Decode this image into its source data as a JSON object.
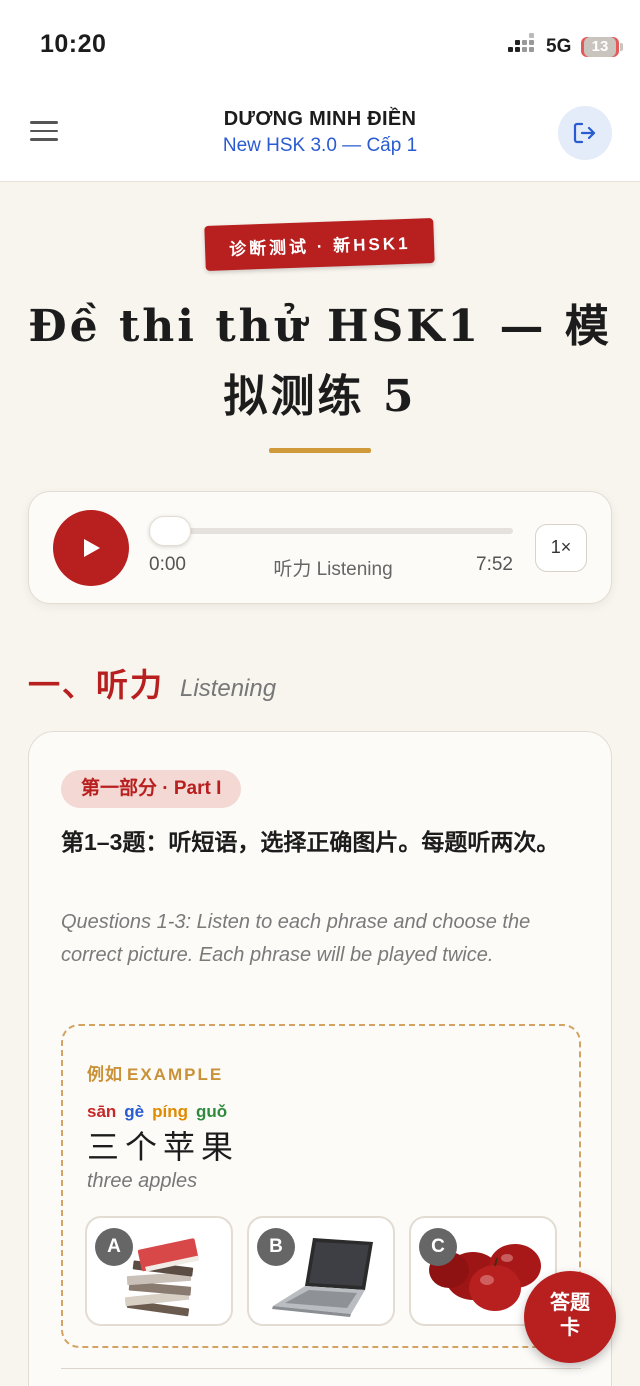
{
  "status_bar": {
    "time": "10:20",
    "network": "5G",
    "battery": "13"
  },
  "header": {
    "user_name": "DƯƠNG MINH ĐIỀN",
    "course": "New HSK 3.0 — Cấp 1",
    "menu_icon": "hamburger-menu-icon",
    "logout_icon": "logout-icon"
  },
  "exam": {
    "badge": "诊断测试 · 新HSK1",
    "title": "Đề thi thử HSK1 — 模拟测练 5"
  },
  "audio_player": {
    "current_time": "0:00",
    "label": "听力 Listening",
    "total_time": "7:52",
    "speed": "1×",
    "progress": 0
  },
  "section": {
    "title_cn": "一、听力",
    "title_en": "Listening"
  },
  "part": {
    "pill": "第一部分 · Part I",
    "instruction_cn": "第1–3题：听短语，选择正确图片。每题听两次。",
    "instruction_en": "Questions 1-3: Listen to each phrase and choose the correct picture. Each phrase will be played twice."
  },
  "example": {
    "label_cn": "例如",
    "label_en": "EXAMPLE",
    "pinyin": [
      {
        "text": "sān",
        "color": "#c62828"
      },
      {
        "text": "gè",
        "color": "#2a5bd1"
      },
      {
        "text": "píng",
        "color": "#e08a00"
      },
      {
        "text": "guǒ",
        "color": "#2e8b3e"
      }
    ],
    "hanzi": "三个苹果",
    "gloss": "three apples",
    "options": [
      {
        "letter": "A",
        "image": "books-stack"
      },
      {
        "letter": "B",
        "image": "laptop"
      },
      {
        "letter": "C",
        "image": "apples"
      }
    ]
  },
  "answer_card_button": "答题卡",
  "colors": {
    "primary": "#b81f1f",
    "accent_gold": "#d09a3a",
    "link_blue": "#2a5bd1",
    "background": "#f8f4ee"
  }
}
